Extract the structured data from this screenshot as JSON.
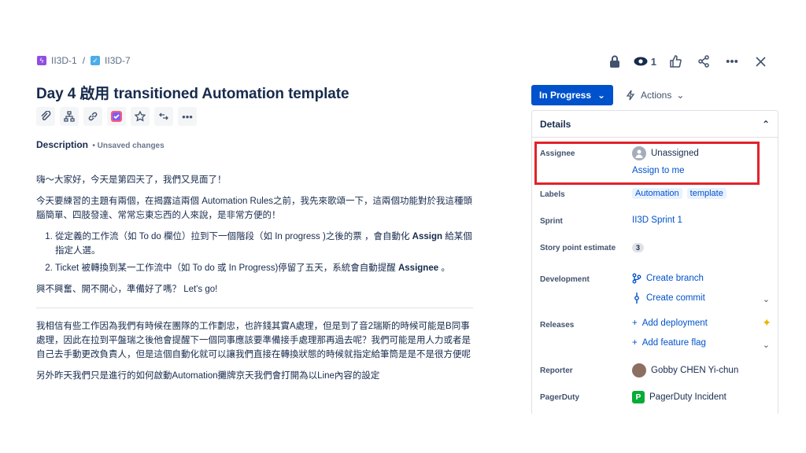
{
  "breadcrumb": {
    "parent_key": "II3D-1",
    "separator": "/",
    "issue_key": "II3D-7"
  },
  "top_actions": {
    "watch_count": "1"
  },
  "title": "Day 4 啟用 transitioned Automation template",
  "description": {
    "heading": "Description",
    "unsaved": "• Unsaved changes",
    "p1": "嗨～大家好，今天是第四天了，我們又見面了！",
    "p2": "今天要練習的主題有兩個，在揭露這兩個 Automation  Rules之前，我先來歌頌一下，這兩個功能對於我這種頭腦簡單、四肢發達、常常忘東忘西的人來說，是非常方便的！",
    "li1_a": "從定義的工作流（如 To do 欄位）拉到下一個階段（如 In progress )之後的票 ，會自動化 ",
    "li1_b": "Assign",
    "li1_c": " 給某個指定人選。",
    "li2_a": "Ticket 被轉換到某一工作流中（如 To do 或 In Progress)停留了五天，系統會自動提醒 ",
    "li2_b": "Assignee",
    "li2_c": " 。",
    "p3": "興不興奮、開不開心，準備好了嗎？ Let's go!",
    "p4": "我相信有些工作因為我們有時候在團隊的工作劃忠，也許錢其實A處理，但是到了音2瑞斯的時候可能是B同事處理，因此在拉到平盤瑞之後他會提醒下一個同事應該要準備接手處理那再過去呢？我們可能是用人力或者是自己去手動更改負責人，但是這個自動化就可以讓我們直接在轉換狀態的時候就指定給筆筒是是不是很方便呢",
    "p5": "另外昨天我們只是進行的如何啟動Automation攤牌京天我們會打開為以Line內容的設定"
  },
  "status": {
    "label": "In Progress"
  },
  "actions": {
    "label": "Actions"
  },
  "details": {
    "heading": "Details",
    "assignee_label": "Assignee",
    "assignee_value": "Unassigned",
    "assign_to_me": "Assign to me",
    "labels_label": "Labels",
    "labels": [
      "Automation",
      "template"
    ],
    "sprint_label": "Sprint",
    "sprint_value": "II3D Sprint 1",
    "story_label": "Story point estimate",
    "story_value": "3",
    "dev_label": "Development",
    "create_branch": "Create branch",
    "create_commit": "Create commit",
    "releases_label": "Releases",
    "add_deployment": "Add deployment",
    "add_feature_flag": "Add feature flag",
    "reporter_label": "Reporter",
    "reporter_value": "Gobby CHEN Yi-chun",
    "pagerduty_label": "PagerDuty",
    "pagerduty_value": "PagerDuty Incident"
  },
  "colors": {
    "primary": "#0052cc",
    "highlight": "#e2222b",
    "epic": "#904ee2",
    "task": "#4bade8"
  }
}
